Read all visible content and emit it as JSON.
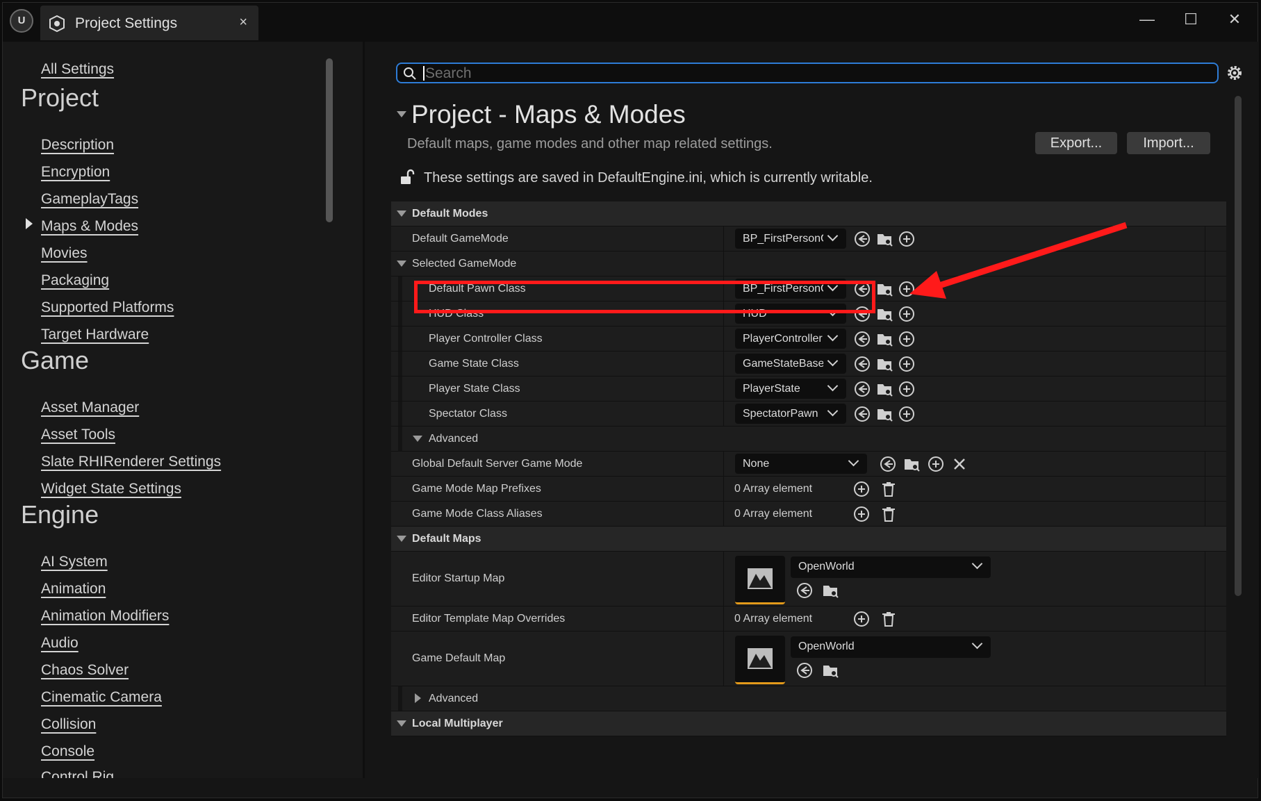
{
  "titlebar": {
    "logo_text": "U",
    "tab_title": "Project Settings",
    "close_glyph": "×",
    "minimize_glyph": "—",
    "maximize_glyph": "☐",
    "window_close_glyph": "✕"
  },
  "sidebar": {
    "all_settings": "All Settings",
    "categories": [
      {
        "title": "Project",
        "items": [
          "Description",
          "Encryption",
          "GameplayTags",
          "Maps & Modes",
          "Movies",
          "Packaging",
          "Supported Platforms",
          "Target Hardware"
        ]
      },
      {
        "title": "Game",
        "items": [
          "Asset Manager",
          "Asset Tools",
          "Slate RHIRenderer Settings",
          "Widget State Settings"
        ]
      },
      {
        "title": "Engine",
        "items": [
          "AI System",
          "Animation",
          "Animation Modifiers",
          "Audio",
          "Chaos Solver",
          "Cinematic Camera",
          "Collision",
          "Console",
          "Control Rig"
        ]
      }
    ],
    "selected_item": "Maps & Modes"
  },
  "search": {
    "placeholder": "Search",
    "value": ""
  },
  "header": {
    "title": "Project - Maps & Modes",
    "description": "Default maps, game modes and other map related settings.",
    "export_label": "Export...",
    "import_label": "Import...",
    "writable_note": "These settings are saved in DefaultEngine.ini, which is currently writable."
  },
  "default_modes": {
    "section_label": "Default Modes",
    "default_gamemode": {
      "label": "Default GameMode",
      "value": "BP_FirstPersonGar"
    },
    "selected_gamemode_label": "Selected GameMode",
    "selected": [
      {
        "label": "Default Pawn Class",
        "value": "BP_FirstPersonCha"
      },
      {
        "label": "HUD Class",
        "value": "HUD"
      },
      {
        "label": "Player Controller Class",
        "value": "PlayerController"
      },
      {
        "label": "Game State Class",
        "value": "GameStateBase"
      },
      {
        "label": "Player State Class",
        "value": "PlayerState"
      },
      {
        "label": "Spectator Class",
        "value": "SpectatorPawn"
      }
    ],
    "advanced_label": "Advanced",
    "global_server_mode": {
      "label": "Global Default Server Game Mode",
      "value": "None"
    },
    "map_prefixes": {
      "label": "Game Mode Map Prefixes",
      "value": "0 Array element"
    },
    "class_aliases": {
      "label": "Game Mode Class Aliases",
      "value": "0 Array element"
    }
  },
  "default_maps": {
    "section_label": "Default Maps",
    "editor_startup_map": {
      "label": "Editor Startup Map",
      "value": "OpenWorld"
    },
    "template_overrides": {
      "label": "Editor Template Map Overrides",
      "value": "0 Array element"
    },
    "game_default_map": {
      "label": "Game Default Map",
      "value": "OpenWorld"
    },
    "advanced_label": "Advanced",
    "next_section_partial": "Local Multiplayer"
  },
  "colors": {
    "accent_focus": "#2e7cd6",
    "annotation_red": "#ff1a1a",
    "map_thumb_accent": "#e39a1b"
  }
}
